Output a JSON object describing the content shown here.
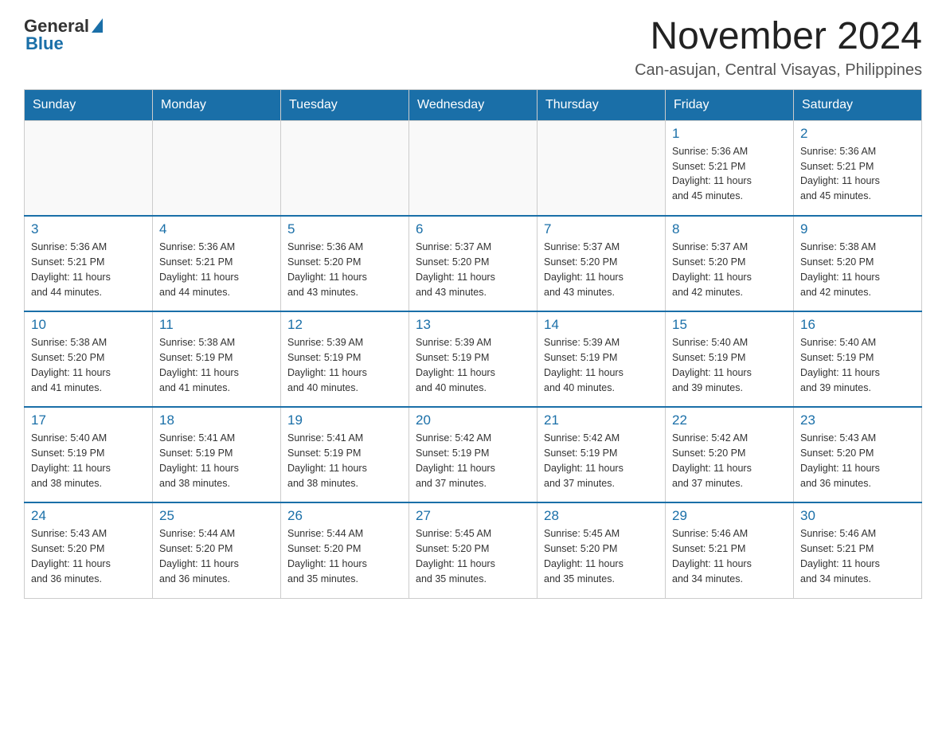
{
  "header": {
    "logo_general": "General",
    "logo_blue": "Blue",
    "month_title": "November 2024",
    "location": "Can-asujan, Central Visayas, Philippines"
  },
  "weekdays": [
    "Sunday",
    "Monday",
    "Tuesday",
    "Wednesday",
    "Thursday",
    "Friday",
    "Saturday"
  ],
  "weeks": [
    [
      {
        "day": "",
        "info": ""
      },
      {
        "day": "",
        "info": ""
      },
      {
        "day": "",
        "info": ""
      },
      {
        "day": "",
        "info": ""
      },
      {
        "day": "",
        "info": ""
      },
      {
        "day": "1",
        "info": "Sunrise: 5:36 AM\nSunset: 5:21 PM\nDaylight: 11 hours\nand 45 minutes."
      },
      {
        "day": "2",
        "info": "Sunrise: 5:36 AM\nSunset: 5:21 PM\nDaylight: 11 hours\nand 45 minutes."
      }
    ],
    [
      {
        "day": "3",
        "info": "Sunrise: 5:36 AM\nSunset: 5:21 PM\nDaylight: 11 hours\nand 44 minutes."
      },
      {
        "day": "4",
        "info": "Sunrise: 5:36 AM\nSunset: 5:21 PM\nDaylight: 11 hours\nand 44 minutes."
      },
      {
        "day": "5",
        "info": "Sunrise: 5:36 AM\nSunset: 5:20 PM\nDaylight: 11 hours\nand 43 minutes."
      },
      {
        "day": "6",
        "info": "Sunrise: 5:37 AM\nSunset: 5:20 PM\nDaylight: 11 hours\nand 43 minutes."
      },
      {
        "day": "7",
        "info": "Sunrise: 5:37 AM\nSunset: 5:20 PM\nDaylight: 11 hours\nand 43 minutes."
      },
      {
        "day": "8",
        "info": "Sunrise: 5:37 AM\nSunset: 5:20 PM\nDaylight: 11 hours\nand 42 minutes."
      },
      {
        "day": "9",
        "info": "Sunrise: 5:38 AM\nSunset: 5:20 PM\nDaylight: 11 hours\nand 42 minutes."
      }
    ],
    [
      {
        "day": "10",
        "info": "Sunrise: 5:38 AM\nSunset: 5:20 PM\nDaylight: 11 hours\nand 41 minutes."
      },
      {
        "day": "11",
        "info": "Sunrise: 5:38 AM\nSunset: 5:19 PM\nDaylight: 11 hours\nand 41 minutes."
      },
      {
        "day": "12",
        "info": "Sunrise: 5:39 AM\nSunset: 5:19 PM\nDaylight: 11 hours\nand 40 minutes."
      },
      {
        "day": "13",
        "info": "Sunrise: 5:39 AM\nSunset: 5:19 PM\nDaylight: 11 hours\nand 40 minutes."
      },
      {
        "day": "14",
        "info": "Sunrise: 5:39 AM\nSunset: 5:19 PM\nDaylight: 11 hours\nand 40 minutes."
      },
      {
        "day": "15",
        "info": "Sunrise: 5:40 AM\nSunset: 5:19 PM\nDaylight: 11 hours\nand 39 minutes."
      },
      {
        "day": "16",
        "info": "Sunrise: 5:40 AM\nSunset: 5:19 PM\nDaylight: 11 hours\nand 39 minutes."
      }
    ],
    [
      {
        "day": "17",
        "info": "Sunrise: 5:40 AM\nSunset: 5:19 PM\nDaylight: 11 hours\nand 38 minutes."
      },
      {
        "day": "18",
        "info": "Sunrise: 5:41 AM\nSunset: 5:19 PM\nDaylight: 11 hours\nand 38 minutes."
      },
      {
        "day": "19",
        "info": "Sunrise: 5:41 AM\nSunset: 5:19 PM\nDaylight: 11 hours\nand 38 minutes."
      },
      {
        "day": "20",
        "info": "Sunrise: 5:42 AM\nSunset: 5:19 PM\nDaylight: 11 hours\nand 37 minutes."
      },
      {
        "day": "21",
        "info": "Sunrise: 5:42 AM\nSunset: 5:19 PM\nDaylight: 11 hours\nand 37 minutes."
      },
      {
        "day": "22",
        "info": "Sunrise: 5:42 AM\nSunset: 5:20 PM\nDaylight: 11 hours\nand 37 minutes."
      },
      {
        "day": "23",
        "info": "Sunrise: 5:43 AM\nSunset: 5:20 PM\nDaylight: 11 hours\nand 36 minutes."
      }
    ],
    [
      {
        "day": "24",
        "info": "Sunrise: 5:43 AM\nSunset: 5:20 PM\nDaylight: 11 hours\nand 36 minutes."
      },
      {
        "day": "25",
        "info": "Sunrise: 5:44 AM\nSunset: 5:20 PM\nDaylight: 11 hours\nand 36 minutes."
      },
      {
        "day": "26",
        "info": "Sunrise: 5:44 AM\nSunset: 5:20 PM\nDaylight: 11 hours\nand 35 minutes."
      },
      {
        "day": "27",
        "info": "Sunrise: 5:45 AM\nSunset: 5:20 PM\nDaylight: 11 hours\nand 35 minutes."
      },
      {
        "day": "28",
        "info": "Sunrise: 5:45 AM\nSunset: 5:20 PM\nDaylight: 11 hours\nand 35 minutes."
      },
      {
        "day": "29",
        "info": "Sunrise: 5:46 AM\nSunset: 5:21 PM\nDaylight: 11 hours\nand 34 minutes."
      },
      {
        "day": "30",
        "info": "Sunrise: 5:46 AM\nSunset: 5:21 PM\nDaylight: 11 hours\nand 34 minutes."
      }
    ]
  ]
}
